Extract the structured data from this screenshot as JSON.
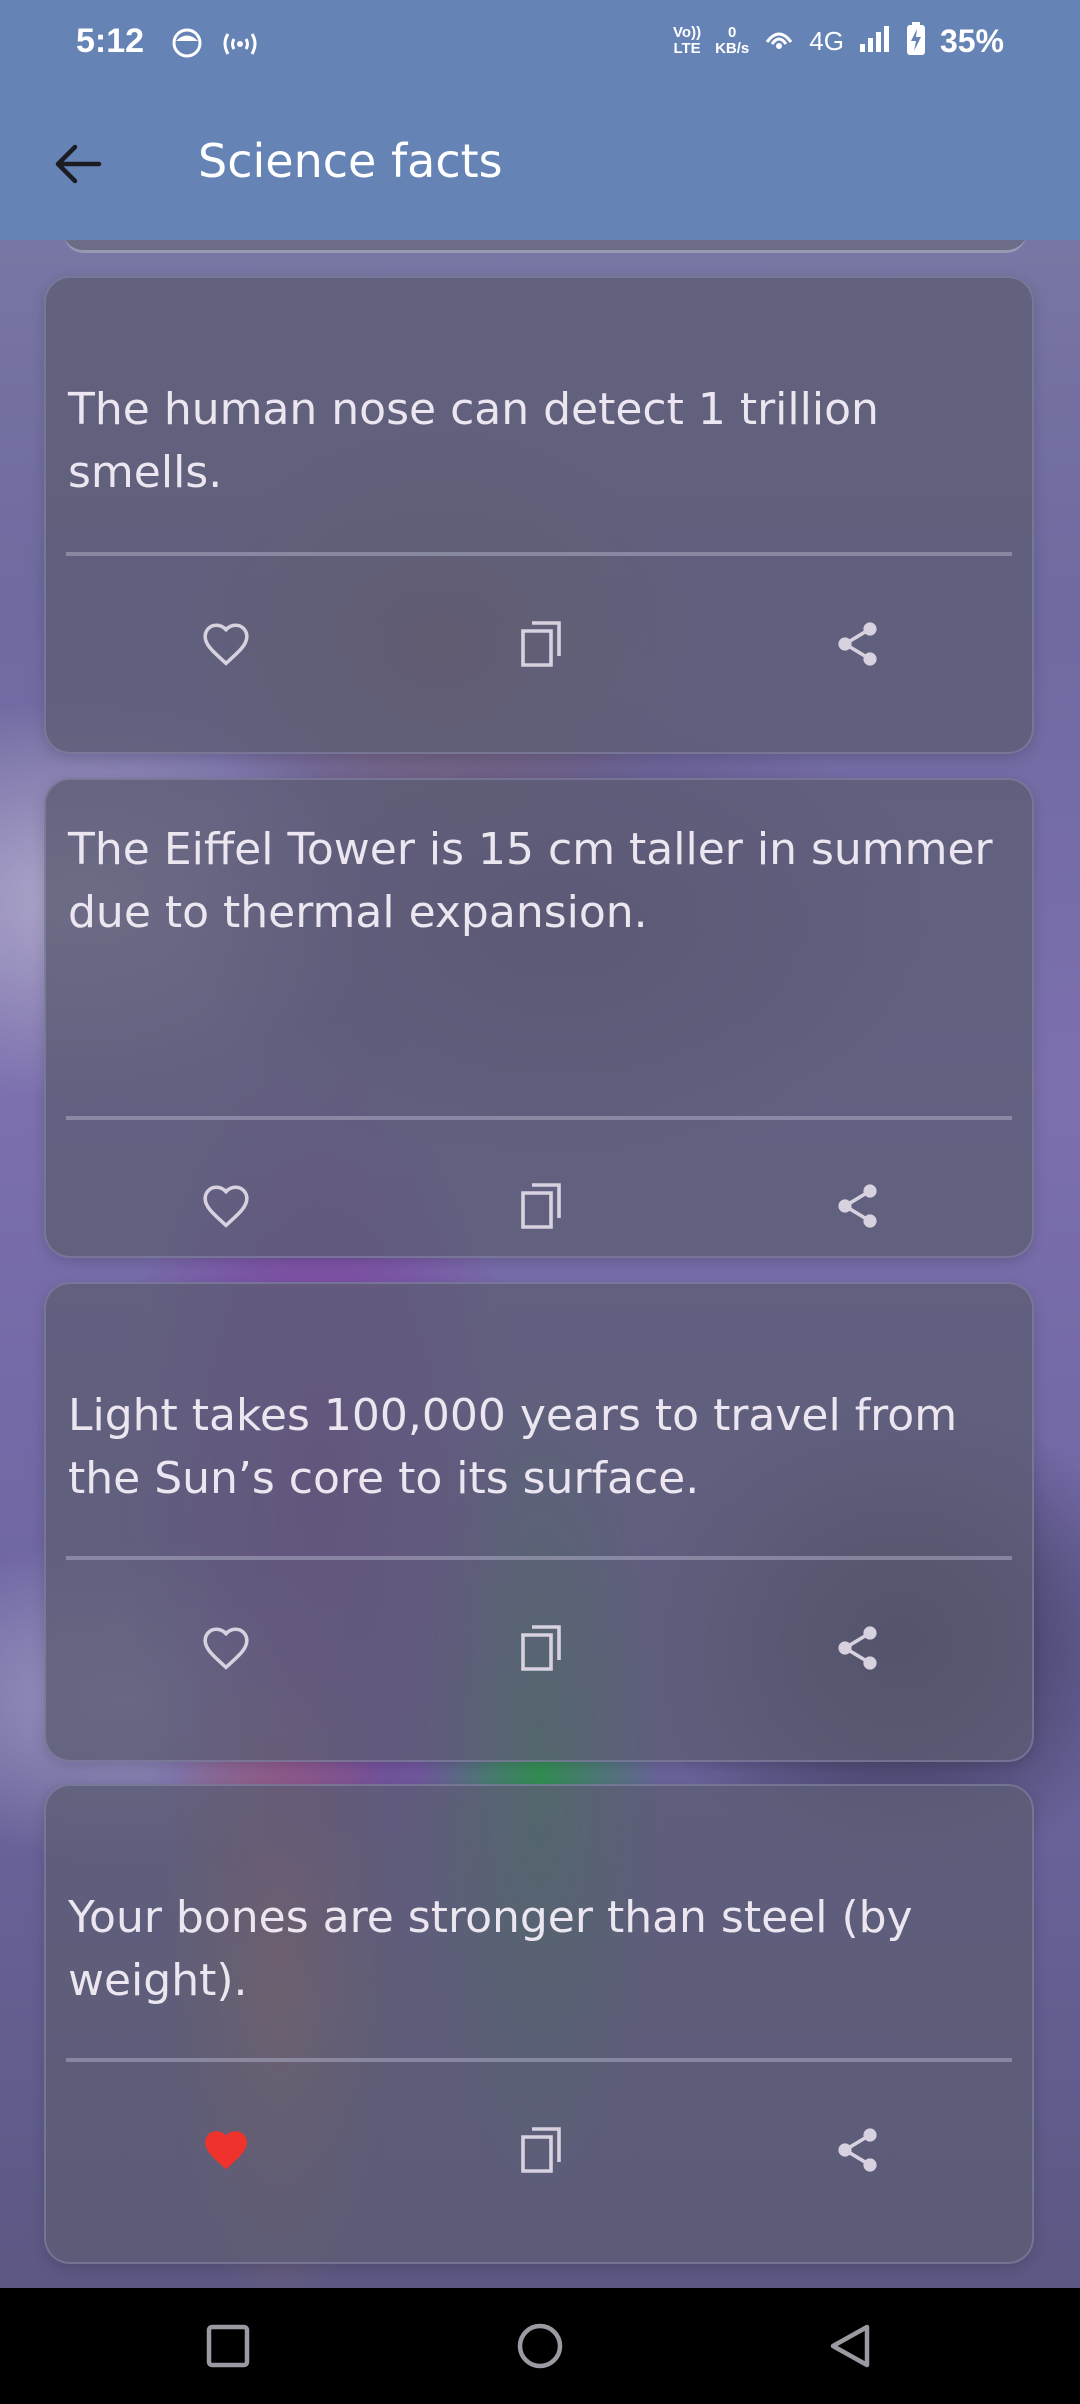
{
  "status_bar": {
    "time": "5:12",
    "volte_line1": "Vo))",
    "volte_line2": "LTE",
    "speed_value": "0",
    "speed_unit": "KB/s",
    "network": "4G",
    "battery_percent": "35%",
    "icons": [
      "face-app-icon",
      "hotspot-icon",
      "wifi-calling-icon",
      "signal-icon",
      "battery-charging-icon"
    ]
  },
  "app_bar": {
    "title": "Science facts",
    "back_icon": "arrow-left-icon"
  },
  "facts": [
    {
      "text": "The human nose can detect 1 trillion smells.",
      "liked": false
    },
    {
      "text": "The Eiffel Tower is 15 cm taller in summer due to thermal expansion.",
      "liked": false
    },
    {
      "text": "Light takes 100,000 years to travel from the Sun’s core to its surface.",
      "liked": false
    },
    {
      "text": "Your bones are stronger than steel (by weight).",
      "liked": true
    }
  ],
  "card_icons": {
    "like": "heart-icon",
    "copy": "copy-icon",
    "share": "share-icon"
  },
  "colors": {
    "app_bar": "#6683b6",
    "like_active": "#f0322c",
    "icon": "#d8d2e0"
  },
  "nav_bar": {
    "icons": [
      "recent-apps-icon",
      "home-icon",
      "back-triangle-icon"
    ]
  }
}
